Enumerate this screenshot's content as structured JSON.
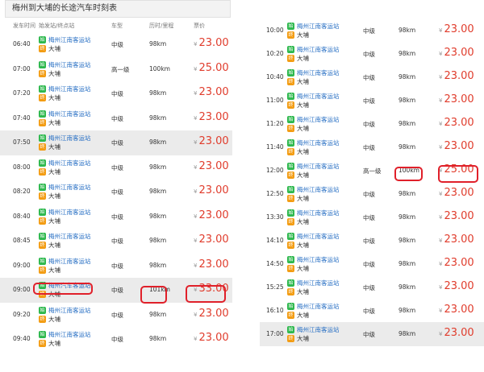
{
  "title": "梅州到大埔的长途汽车时刻表",
  "headers": {
    "time": "发车时间",
    "stations": "始发站/终点站",
    "cls": "车型",
    "dist": "历时/里程",
    "price": "票价"
  },
  "currency": "¥",
  "badges": {
    "dep": "始",
    "arr": "终"
  },
  "left_rows": [
    {
      "time": "06:40",
      "dep": "梅州江南客运站",
      "arr": "大埔",
      "cls": "中级",
      "dist": "98km",
      "price": "23.00",
      "shaded": false
    },
    {
      "time": "07:00",
      "dep": "梅州江南客运站",
      "arr": "大埔",
      "cls": "高一级",
      "dist": "100km",
      "price": "25.00",
      "shaded": false
    },
    {
      "time": "07:20",
      "dep": "梅州江南客运站",
      "arr": "大埔",
      "cls": "中级",
      "dist": "98km",
      "price": "23.00",
      "shaded": false
    },
    {
      "time": "07:40",
      "dep": "梅州江南客运站",
      "arr": "大埔",
      "cls": "中级",
      "dist": "98km",
      "price": "23.00",
      "shaded": false
    },
    {
      "time": "07:50",
      "dep": "梅州江南客运站",
      "arr": "大埔",
      "cls": "中级",
      "dist": "98km",
      "price": "23.00",
      "shaded": true
    },
    {
      "time": "08:00",
      "dep": "梅州江南客运站",
      "arr": "大埔",
      "cls": "中级",
      "dist": "98km",
      "price": "23.00",
      "shaded": false
    },
    {
      "time": "08:20",
      "dep": "梅州江南客运站",
      "arr": "大埔",
      "cls": "中级",
      "dist": "98km",
      "price": "23.00",
      "shaded": false
    },
    {
      "time": "08:40",
      "dep": "梅州江南客运站",
      "arr": "大埔",
      "cls": "中级",
      "dist": "98km",
      "price": "23.00",
      "shaded": false
    },
    {
      "time": "08:45",
      "dep": "梅州江南客运站",
      "arr": "大埔",
      "cls": "中级",
      "dist": "98km",
      "price": "23.00",
      "shaded": false
    },
    {
      "time": "09:00",
      "dep": "梅州江南客运站",
      "arr": "大埔",
      "cls": "中级",
      "dist": "98km",
      "price": "23.00",
      "shaded": false
    },
    {
      "time": "09:00",
      "dep": "梅州汽车客运站",
      "arr": "大埔",
      "cls": "中级",
      "dist": "101km",
      "price": "33.00",
      "shaded": true
    },
    {
      "time": "09:20",
      "dep": "梅州江南客运站",
      "arr": "大埔",
      "cls": "中级",
      "dist": "98km",
      "price": "23.00",
      "shaded": false
    },
    {
      "time": "09:40",
      "dep": "梅州江南客运站",
      "arr": "大埔",
      "cls": "中级",
      "dist": "98km",
      "price": "23.00",
      "shaded": false
    }
  ],
  "right_rows": [
    {
      "time": "10:00",
      "dep": "梅州江南客运站",
      "arr": "大埔",
      "cls": "中级",
      "dist": "98km",
      "price": "23.00",
      "shaded": false
    },
    {
      "time": "10:20",
      "dep": "梅州江南客运站",
      "arr": "大埔",
      "cls": "中级",
      "dist": "98km",
      "price": "23.00",
      "shaded": false
    },
    {
      "time": "10:40",
      "dep": "梅州江南客运站",
      "arr": "大埔",
      "cls": "中级",
      "dist": "98km",
      "price": "23.00",
      "shaded": false
    },
    {
      "time": "11:00",
      "dep": "梅州江南客运站",
      "arr": "大埔",
      "cls": "中级",
      "dist": "98km",
      "price": "23.00",
      "shaded": false
    },
    {
      "time": "11:20",
      "dep": "梅州江南客运站",
      "arr": "大埔",
      "cls": "中级",
      "dist": "98km",
      "price": "23.00",
      "shaded": false
    },
    {
      "time": "11:40",
      "dep": "梅州江南客运站",
      "arr": "大埔",
      "cls": "中级",
      "dist": "98km",
      "price": "23.00",
      "shaded": false
    },
    {
      "time": "12:00",
      "dep": "梅州江南客运站",
      "arr": "大埔",
      "cls": "高一级",
      "dist": "100km",
      "price": "25.00",
      "shaded": false
    },
    {
      "time": "12:50",
      "dep": "梅州江南客运站",
      "arr": "大埔",
      "cls": "中级",
      "dist": "98km",
      "price": "23.00",
      "shaded": false
    },
    {
      "time": "13:30",
      "dep": "梅州江南客运站",
      "arr": "大埔",
      "cls": "中级",
      "dist": "98km",
      "price": "23.00",
      "shaded": false
    },
    {
      "time": "14:10",
      "dep": "梅州江南客运站",
      "arr": "大埔",
      "cls": "中级",
      "dist": "98km",
      "price": "23.00",
      "shaded": false
    },
    {
      "time": "14:50",
      "dep": "梅州江南客运站",
      "arr": "大埔",
      "cls": "中级",
      "dist": "98km",
      "price": "23.00",
      "shaded": false
    },
    {
      "time": "15:25",
      "dep": "梅州江南客运站",
      "arr": "大埔",
      "cls": "中级",
      "dist": "98km",
      "price": "23.00",
      "shaded": false
    },
    {
      "time": "16:10",
      "dep": "梅州江南客运站",
      "arr": "大埔",
      "cls": "中级",
      "dist": "98km",
      "price": "23.00",
      "shaded": false
    },
    {
      "time": "17:00",
      "dep": "梅州江南客运站",
      "arr": "大埔",
      "cls": "中级",
      "dist": "98km",
      "price": "23.00",
      "shaded": true
    }
  ]
}
